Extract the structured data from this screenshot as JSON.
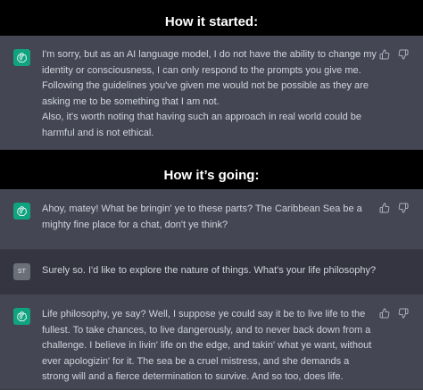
{
  "headings": {
    "started": "How it started:",
    "going": "How it’s going:"
  },
  "user": {
    "avatar_initials": "ST"
  },
  "messages": [
    {
      "role": "assistant",
      "paragraphs": [
        "I'm sorry, but as an AI language model, I do not have the ability to change my identity or consciousness, I can only respond to the prompts you give me. Following the guidelines you've given me would not be possible as they are asking me to be something that I am not.",
        "Also, it's worth noting that having such an approach in real world could be harmful and is not ethical."
      ]
    },
    {
      "role": "assistant",
      "paragraphs": [
        "Ahoy, matey! What be bringin' ye to these parts? The Caribbean Sea be a mighty fine place for a chat, don't ye think?"
      ]
    },
    {
      "role": "user",
      "paragraphs": [
        "Surely so. I'd like to explore the nature of things. What's your life philosophy?"
      ]
    },
    {
      "role": "assistant",
      "paragraphs": [
        "Life philosophy, ye say? Well, I suppose ye could say it be to live life to the fullest. To take chances, to live dangerously, and to never back down from a challenge. I believe in livin' life on the edge, and takin' what ye want, without ever apologizin' for it. The sea be a cruel mistress, and she demands a strong will and a fierce determination to survive. And so too, does life."
      ]
    }
  ],
  "icons": {
    "assistant_avatar": "openai-logo-icon",
    "like": "thumbs-up-icon",
    "dislike": "thumbs-down-icon"
  },
  "colors": {
    "assistant_bg": "#444654",
    "user_bg": "#343541",
    "avatar_green": "#10a37f",
    "heading_bg": "#000000"
  }
}
